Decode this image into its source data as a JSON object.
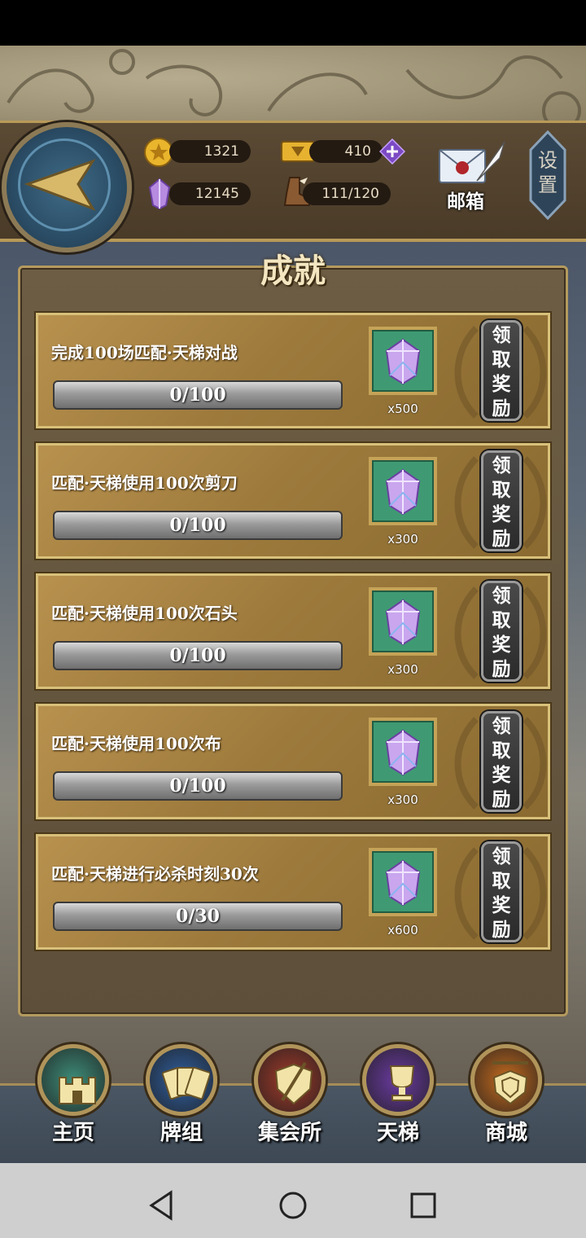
{
  "resources": {
    "gold": "1321",
    "ticket": "410",
    "crystal": "12145",
    "stamina": "111/120"
  },
  "header": {
    "mail_label": "邮箱",
    "settings_label": "设置"
  },
  "panel": {
    "title": "成就"
  },
  "achievements": [
    {
      "title": "完成100场匹配·天梯对战",
      "progress": "0/100",
      "reward_qty": "x500",
      "claim_label": "领取奖励"
    },
    {
      "title": "匹配·天梯使用100次剪刀",
      "progress": "0/100",
      "reward_qty": "x300",
      "claim_label": "领取奖励"
    },
    {
      "title": "匹配·天梯使用100次石头",
      "progress": "0/100",
      "reward_qty": "x300",
      "claim_label": "领取奖励"
    },
    {
      "title": "匹配·天梯使用100次布",
      "progress": "0/100",
      "reward_qty": "x300",
      "claim_label": "领取奖励"
    },
    {
      "title": "匹配·天梯进行必杀时刻30次",
      "progress": "0/30",
      "reward_qty": "x600",
      "claim_label": "领取奖励"
    }
  ],
  "nav": [
    {
      "label": "主页",
      "icon": "castle-icon",
      "color": "#3d8c78"
    },
    {
      "label": "牌组",
      "icon": "cards-icon",
      "color": "#2f5fa0"
    },
    {
      "label": "集会所",
      "icon": "shield-sword-icon",
      "color": "#a23a2a"
    },
    {
      "label": "天梯",
      "icon": "trophy-icon",
      "color": "#6a3aa0"
    },
    {
      "label": "商城",
      "icon": "shop-sign-icon",
      "color": "#c46a1e"
    }
  ]
}
